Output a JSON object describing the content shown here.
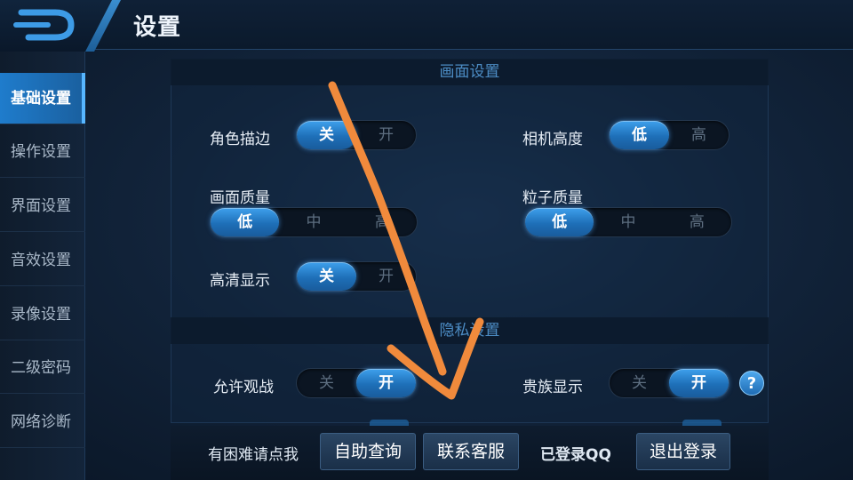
{
  "header": {
    "title": "设置",
    "back_icon": "back-logo-icon"
  },
  "sidebar": {
    "items": [
      {
        "label": "基础设置",
        "active": true
      },
      {
        "label": "操作设置",
        "active": false
      },
      {
        "label": "界面设置",
        "active": false
      },
      {
        "label": "音效设置",
        "active": false
      },
      {
        "label": "录像设置",
        "active": false
      },
      {
        "label": "二级密码",
        "active": false
      },
      {
        "label": "网络诊断",
        "active": false
      }
    ]
  },
  "display_section": {
    "title": "画面设置",
    "settings": {
      "outline": {
        "label": "角色描边",
        "options": [
          "关",
          "开"
        ],
        "selected": "关"
      },
      "camera_height": {
        "label": "相机高度",
        "options": [
          "低",
          "高"
        ],
        "selected": "低"
      },
      "quality": {
        "label": "画面质量",
        "options": [
          "低",
          "中",
          "高"
        ],
        "selected": "低"
      },
      "particle": {
        "label": "粒子质量",
        "options": [
          "低",
          "中",
          "高"
        ],
        "selected": "低"
      },
      "hd": {
        "label": "高清显示",
        "options": [
          "关",
          "开"
        ],
        "selected": "关"
      }
    }
  },
  "privacy_section": {
    "title": "隐私设置",
    "settings": {
      "spectate": {
        "label": "允许观战",
        "options": [
          "关",
          "开"
        ],
        "selected": "开"
      },
      "noble": {
        "label": "贵族显示",
        "options": [
          "关",
          "开"
        ],
        "selected": "开"
      }
    },
    "help_label": "?"
  },
  "bottom": {
    "help_text": "有困难请点我",
    "self_query_label": "自助查询",
    "contact_label": "联系客服",
    "login_status": "已登录QQ",
    "logout_label": "退出登录"
  },
  "colors": {
    "accent": "#1e6fb8",
    "annotation": "#f08a3c"
  }
}
